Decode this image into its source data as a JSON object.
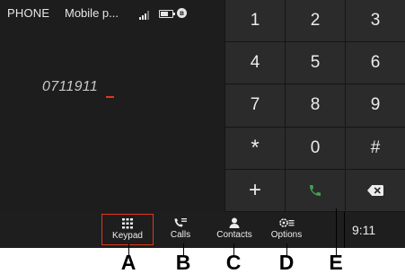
{
  "statusbar": {
    "app_title": "PHONE",
    "network": "Mobile p...",
    "signal_bars": 3,
    "battery_fraction": 0.6,
    "bluetooth_icon": "bluetooth-icon"
  },
  "dial": {
    "number": "0711911"
  },
  "keypad": {
    "keys": [
      "1",
      "2",
      "3",
      "4",
      "5",
      "6",
      "7",
      "8",
      "9",
      "*",
      "0",
      "#",
      "+",
      "call",
      "delete"
    ]
  },
  "nav": {
    "keypad_label": "Keypad",
    "calls_label": "Calls",
    "contacts_label": "Contacts",
    "options_label": "Options"
  },
  "clock": "9:11",
  "callouts": [
    "A",
    "B",
    "C",
    "D",
    "E"
  ],
  "colors": {
    "accent": "#e2371d",
    "call_green": "#3fa34a",
    "background": "#000000"
  }
}
